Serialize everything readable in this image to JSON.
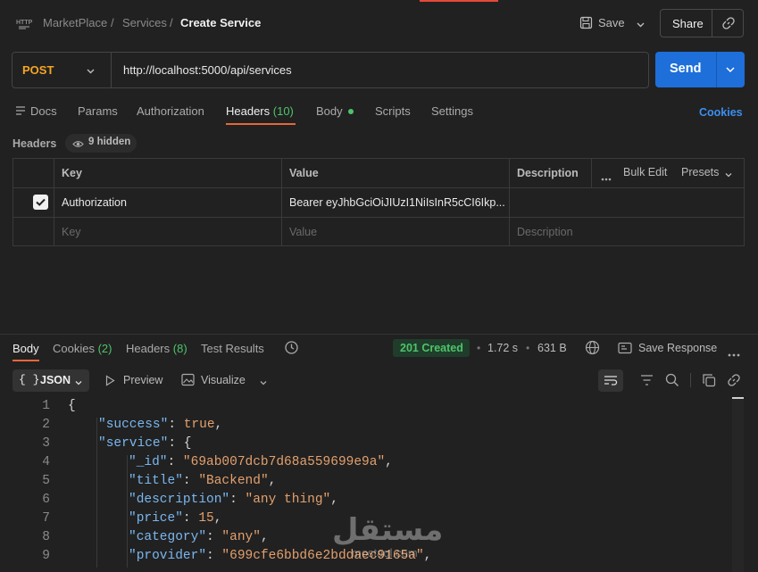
{
  "breadcrumb": {
    "root": "MarketPlace",
    "sep1": "/",
    "middle": "Services",
    "sep2": "/",
    "current": "Create Service"
  },
  "toolbar": {
    "save_label": "Save",
    "share_label": "Share"
  },
  "request": {
    "method": "POST",
    "url": "http://localhost:5000/api/services",
    "send_label": "Send"
  },
  "request_tabs": {
    "docs": "Docs",
    "params": "Params",
    "authorization": "Authorization",
    "headers": "Headers",
    "headers_count": "(10)",
    "body": "Body",
    "scripts": "Scripts",
    "settings": "Settings",
    "cookies": "Cookies"
  },
  "headers_section": {
    "title": "Headers",
    "hidden": "9 hidden"
  },
  "headers_table": {
    "columns": {
      "key": "Key",
      "value": "Value",
      "description": "Description"
    },
    "bulk_edit": "Bulk Edit",
    "presets": "Presets",
    "rows": [
      {
        "key": "Authorization",
        "value": "Bearer eyJhbGciOiJIUzI1NiIsInR5cCI6Ikp...",
        "description": ""
      }
    ],
    "placeholder": {
      "key": "Key",
      "value": "Value",
      "description": "Description"
    }
  },
  "response_tabs": {
    "body": "Body",
    "cookies": "Cookies",
    "cookies_count": "(2)",
    "headers": "Headers",
    "headers_count": "(8)",
    "test_results": "Test Results"
  },
  "response_meta": {
    "status": "201 Created",
    "time": "1.72 s",
    "size": "631 B",
    "save_response": "Save Response",
    "sep1": "•",
    "sep2": "•"
  },
  "response_view": {
    "format": "JSON",
    "preview": "Preview",
    "visualize": "Visualize"
  },
  "code_lines": [
    {
      "n": "1",
      "indent": 0,
      "parts": [
        {
          "t": "{",
          "c": "p"
        }
      ]
    },
    {
      "n": "2",
      "indent": 1,
      "parts": [
        {
          "t": "\"success\"",
          "c": "k"
        },
        {
          "t": ": ",
          "c": "p"
        },
        {
          "t": "true",
          "c": "b"
        },
        {
          "t": ",",
          "c": "p"
        }
      ]
    },
    {
      "n": "3",
      "indent": 1,
      "parts": [
        {
          "t": "\"service\"",
          "c": "k"
        },
        {
          "t": ": {",
          "c": "p"
        }
      ]
    },
    {
      "n": "4",
      "indent": 2,
      "parts": [
        {
          "t": "\"_id\"",
          "c": "k"
        },
        {
          "t": ": ",
          "c": "p"
        },
        {
          "t": "\"69ab007dcb7d68a559699e9a\"",
          "c": "s"
        },
        {
          "t": ",",
          "c": "p"
        }
      ]
    },
    {
      "n": "5",
      "indent": 2,
      "parts": [
        {
          "t": "\"title\"",
          "c": "k"
        },
        {
          "t": ": ",
          "c": "p"
        },
        {
          "t": "\"Backend\"",
          "c": "s"
        },
        {
          "t": ",",
          "c": "p"
        }
      ]
    },
    {
      "n": "6",
      "indent": 2,
      "parts": [
        {
          "t": "\"description\"",
          "c": "k"
        },
        {
          "t": ": ",
          "c": "p"
        },
        {
          "t": "\"any thing\"",
          "c": "s"
        },
        {
          "t": ",",
          "c": "p"
        }
      ]
    },
    {
      "n": "7",
      "indent": 2,
      "parts": [
        {
          "t": "\"price\"",
          "c": "k"
        },
        {
          "t": ": ",
          "c": "p"
        },
        {
          "t": "15",
          "c": "b"
        },
        {
          "t": ",",
          "c": "p"
        }
      ]
    },
    {
      "n": "8",
      "indent": 2,
      "parts": [
        {
          "t": "\"category\"",
          "c": "k"
        },
        {
          "t": ": ",
          "c": "p"
        },
        {
          "t": "\"any\"",
          "c": "s"
        },
        {
          "t": ",",
          "c": "p"
        }
      ]
    },
    {
      "n": "9",
      "indent": 2,
      "parts": [
        {
          "t": "\"provider\"",
          "c": "k"
        },
        {
          "t": ": ",
          "c": "p"
        },
        {
          "t": "\"699cfe6bbd6e2bddaec9165a\"",
          "c": "s"
        },
        {
          "t": ",",
          "c": "p"
        }
      ]
    }
  ],
  "watermark": {
    "arabic": "مستقل",
    "latin": "mostaql.com"
  },
  "colors": {
    "accent": "#1e6fd9",
    "method": "#f5a623",
    "status_bg": "#1f3d2a",
    "status_fg": "#4fc36b",
    "tab_underline": "#e5673a",
    "cookies_link": "#3b8ff0"
  }
}
